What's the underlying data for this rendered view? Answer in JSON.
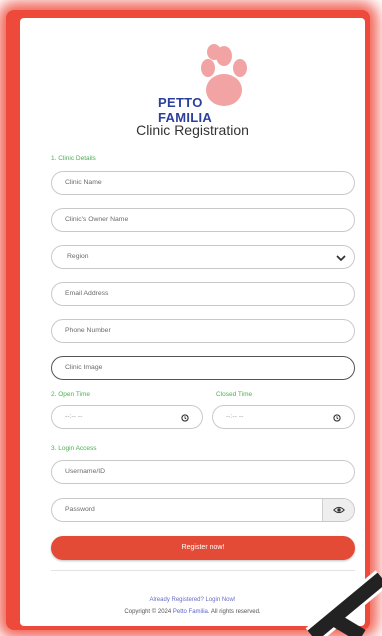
{
  "brand": {
    "line1": "PETTO",
    "line2": "FAMILIA",
    "colors": {
      "text": "#2b3f9c",
      "paw": "#f2a3a3"
    }
  },
  "form": {
    "title": "Clinic Registration",
    "sections": {
      "clinic_details": "1. Clinic Details",
      "open_time": "2. Open Time",
      "closed_time": "Closed Time",
      "login_access": "3. Login Access"
    },
    "fields": {
      "clinic_name": "Clinic Name",
      "owner_name": "Clinic's Owner Name",
      "region": "Region",
      "email": "Email Address",
      "phone": "Phone Number",
      "clinic_image": "Clinic Image",
      "open_time": "--:-- --",
      "closed_time": "--:-- --",
      "username": "Username/ID",
      "password": "Password"
    },
    "submit_label": "Register now!"
  },
  "footer": {
    "login_link": "Already Registered? Login Now!",
    "copyright_prefix": "Copyright © 2024 ",
    "copyright_brand": "Petto Familia",
    "copyright_suffix": ". All rights reserved."
  },
  "colors": {
    "accent": "#e44b37",
    "section_label": "#4caf50",
    "border": "#c9c9c9"
  },
  "icons": {
    "region_chevron": "chevron-down-icon",
    "time": "clock-icon",
    "password_toggle": "eye-icon"
  }
}
